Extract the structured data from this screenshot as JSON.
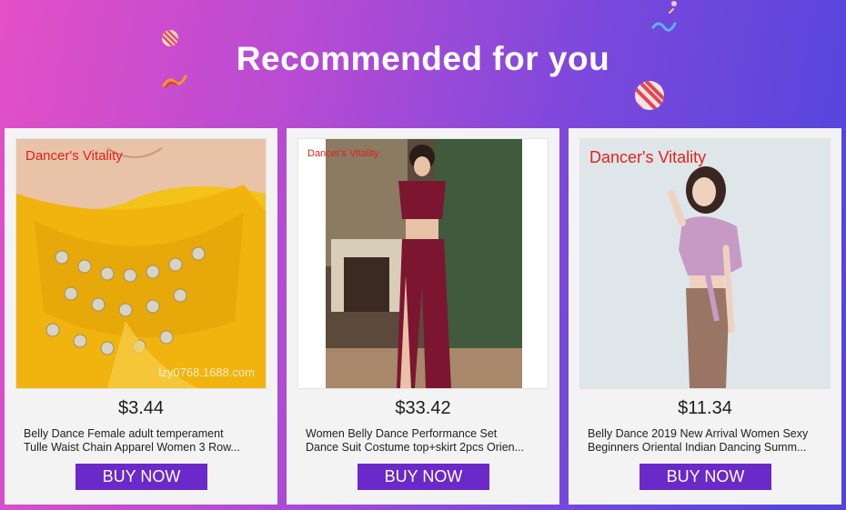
{
  "header": {
    "title": "Recommended for you"
  },
  "colors": {
    "button": "#6a29c8",
    "brand_text": "#e2221d",
    "card_bg": "#f3f3f3"
  },
  "decorations": [
    "striped-ball-icon",
    "ribbon-icon",
    "striped-ball-icon",
    "squiggle-icon"
  ],
  "products": [
    {
      "brand": "Dancer's Vitality",
      "watermark": "lzy0768.1688.com",
      "price": "$3.44",
      "name_line1": "Belly Dance Female adult temperament",
      "name_line2": "Tulle Waist Chain Apparel Women 3 Row...",
      "button": "BUY NOW"
    },
    {
      "brand": "Dancer's Vitality",
      "price": "$33.42",
      "name_line1": "Women Belly Dance Performance Set",
      "name_line2": "Dance Suit Costume top+skirt 2pcs Orien...",
      "button": "BUY NOW"
    },
    {
      "brand": "Dancer's Vitality",
      "price": "$11.34",
      "name_line1": "Belly Dance 2019 New Arrival Women Sexy",
      "name_line2": "Beginners Oriental Indian Dancing Summ...",
      "button": "BUY NOW"
    }
  ]
}
